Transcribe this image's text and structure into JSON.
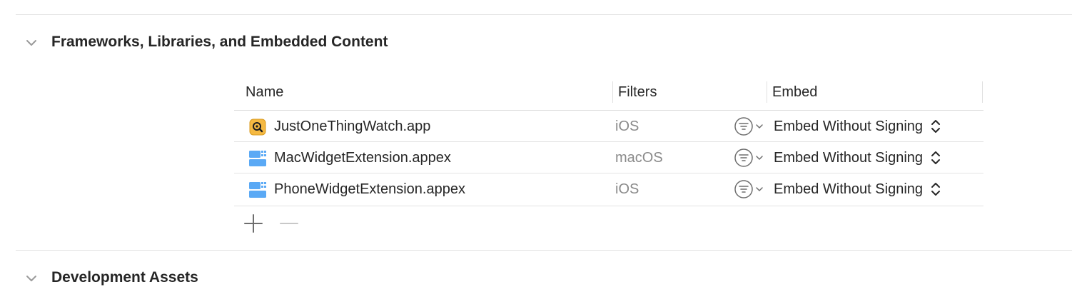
{
  "sections": [
    {
      "title": "Frameworks, Libraries, and Embedded Content",
      "expanded": true
    },
    {
      "title": "Development Assets",
      "expanded": true
    }
  ],
  "table": {
    "columns": [
      "Name",
      "Filters",
      "Embed"
    ],
    "rows": [
      {
        "icon": "watch-app-icon",
        "name": "JustOneThingWatch.app",
        "filter": "iOS",
        "embed": "Embed Without Signing"
      },
      {
        "icon": "app-extension-icon",
        "name": "MacWidgetExtension.appex",
        "filter": "macOS",
        "embed": "Embed Without Signing"
      },
      {
        "icon": "app-extension-icon",
        "name": "PhoneWidgetExtension.appex",
        "filter": "iOS",
        "embed": "Embed Without Signing"
      }
    ]
  },
  "colors": {
    "accent_orange": "#f5b942",
    "extension_blue": "#5aa9f5",
    "secondary_text": "#8a8a8a"
  }
}
